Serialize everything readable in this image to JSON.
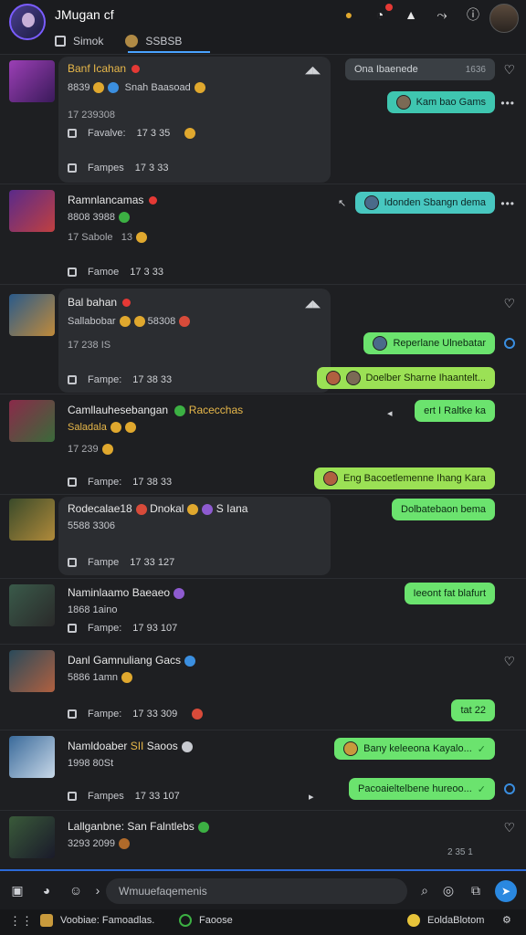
{
  "header": {
    "title": "JMugan cf",
    "tabs": [
      {
        "label": "Simok"
      },
      {
        "label": "SSBSB"
      }
    ]
  },
  "feed": [
    {
      "name": "Banf Icahan",
      "line2": "8839",
      "line2b": "Snah Baasoad",
      "meta": "17 239308",
      "foot1_label": "Favalve:",
      "foot1_stat": "17 3 35",
      "foot2_label": "Fampes",
      "foot2_stat": "17 3 33",
      "bubbles": [
        {
          "text": "Ona Ibaenede",
          "time": "1636"
        },
        {
          "text": "Kam bao Gams"
        }
      ]
    },
    {
      "name": "Ramnlancamas",
      "line2": "8808 3988",
      "meta": "17 Sabole",
      "meta_b": "13",
      "foot2_label": "Famoe",
      "foot2_stat": "17 3 33",
      "bubbles": [
        {
          "text": "Idonden Sbangn dema"
        }
      ]
    },
    {
      "name": "Bal bahan",
      "line2": "Sallabobar",
      "line2b": "58308",
      "meta": "17 238 IS",
      "foot2_label": "Fampe:",
      "foot2_stat": "17 38 33",
      "bubbles": [
        {
          "text": "Reperlane Ulnebatar"
        },
        {
          "text": "Doelber Sharne Ihaantelt..."
        }
      ]
    },
    {
      "name": "Camllauhesebangan",
      "name_b": "Racecchas",
      "line2": "Saladala",
      "meta": "17 239",
      "foot2_label": "Fampe:",
      "foot2_stat": "17 38 33",
      "bubbles": [
        {
          "text": "ert I Raltke ka"
        },
        {
          "text": "Eng Bacoetlemenne Ihang Kara"
        }
      ]
    },
    {
      "name": "Rodecalae18",
      "name_b": "Dnokal",
      "name_c": "S Iana",
      "line2": "5588 3306",
      "foot2_label": "Fampe",
      "foot2_stat": "17 33 127",
      "bubbles": [
        {
          "text": "Dolbatebaon bema"
        }
      ]
    },
    {
      "name": "Naminlaamo Baeaeo",
      "line2": "1868 1aino",
      "foot2_label": "Fampe:",
      "foot2_stat": "17 93 107",
      "bubbles": [
        {
          "text": "Ieeont fat blafurt"
        }
      ]
    },
    {
      "name": "Danl Gamnuliang Gacs",
      "line2": "5886 1amn",
      "foot2_label": "Fampe:",
      "foot2_stat": "17 33 309",
      "bubbles": [
        {
          "text": "tat 22"
        }
      ]
    },
    {
      "name": "Namldoaber",
      "name_b": "SII",
      "name_c": "Saoos",
      "line2": "1998 80St",
      "foot2_label": "Fampes",
      "foot2_stat": "17 33 107",
      "bubbles": [
        {
          "text": "Bany keleeona Kayalo..."
        },
        {
          "text": "Pacoaieltelbene hureoo..."
        }
      ]
    },
    {
      "name": "Lallganbne:",
      "name_b": "San",
      "name_c": "Falntlebs",
      "line2": "3293 2099",
      "right_stat": "2 35 1"
    }
  ],
  "composer": {
    "placeholder": "Wmuuefaqemenis"
  },
  "bottombar": {
    "item1": "Voobiae: Famoadlas.",
    "item2": "Faoose",
    "item3": "EoldaBlotom"
  }
}
